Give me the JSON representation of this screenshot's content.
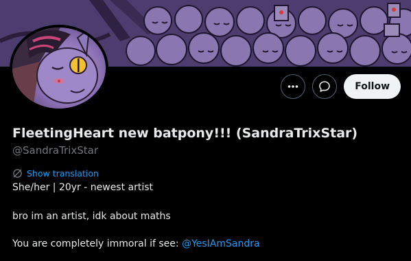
{
  "profile": {
    "display_name": "FleetingHeart new batpony!!! (SandraTrixStar)",
    "handle": "@SandraTrixStar",
    "translate_label": "Show translation",
    "bio": {
      "line1": "She/her | 20yr - newest artist",
      "line2": "bro im an artist, idk about maths",
      "line3_prefix": "You are completely immoral if see: ",
      "line3_mention": "@YesIAmSandra"
    }
  },
  "actions": {
    "more_icon": "more-icon",
    "message_icon": "message-icon",
    "follow_label": "Follow"
  },
  "colors": {
    "background": "#000000",
    "text_primary": "#e7e9ea",
    "text_secondary": "#71767b",
    "link": "#1d9bf0",
    "follow_bg": "#eff3f4",
    "banner": "#55447a"
  }
}
